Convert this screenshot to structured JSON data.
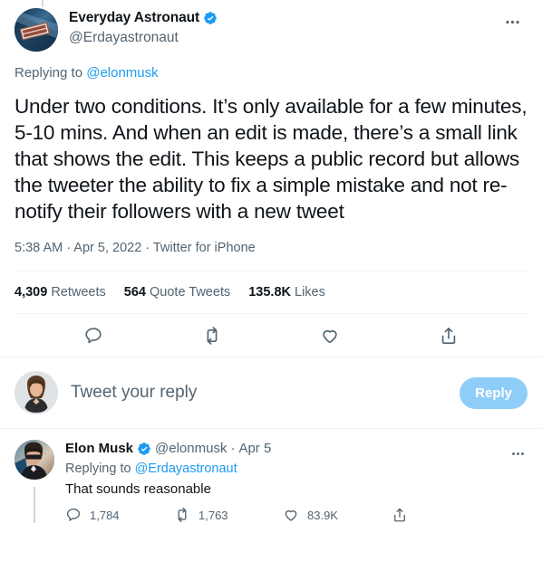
{
  "main_tweet": {
    "display_name": "Everyday Astronaut",
    "verified": true,
    "handle": "@Erdayastronaut",
    "replying_to_label": "Replying to ",
    "replying_to_mention": "@elonmusk",
    "text": "Under two conditions. It’s only available for a few minutes, 5-10 mins. And when an edit is made, there’s a small link that shows the edit. This keeps a public record but allows the tweeter the ability to fix a simple mistake and not re-notify their followers with a new tweet",
    "meta": "5:38 AM · Apr 5, 2022 · Twitter for iPhone",
    "stats": [
      {
        "count": "4,309",
        "label": "Retweets"
      },
      {
        "count": "564",
        "label": "Quote Tweets"
      },
      {
        "count": "135.8K",
        "label": "Likes"
      }
    ],
    "actions": [
      "reply-icon",
      "retweet-icon",
      "like-icon",
      "share-icon"
    ],
    "more_icon": "more-horizontal-icon"
  },
  "composer": {
    "placeholder": "Tweet your reply",
    "reply_button_label": "Reply",
    "reply_button_color": "#8ecdf8",
    "avatar_name": "your-avatar"
  },
  "reply_tweet": {
    "display_name": "Elon Musk",
    "verified": true,
    "handle": "@elonmusk",
    "separator": "·",
    "date": "Apr 5",
    "replying_to_label": "Replying to ",
    "replying_to_mention": "@Erdayastronaut",
    "text": "That sounds reasonable",
    "actions": [
      {
        "icon": "reply-icon",
        "count": "1,784"
      },
      {
        "icon": "retweet-icon",
        "count": "1,763"
      },
      {
        "icon": "like-icon",
        "count": "83.9K"
      },
      {
        "icon": "share-icon",
        "count": ""
      }
    ],
    "more_icon": "more-horizontal-icon"
  },
  "colors": {
    "accent": "#1d9bf0",
    "text": "#0f1419",
    "muted": "#536471",
    "divider": "#eff3f4",
    "thread_line": "#cfd9de"
  }
}
